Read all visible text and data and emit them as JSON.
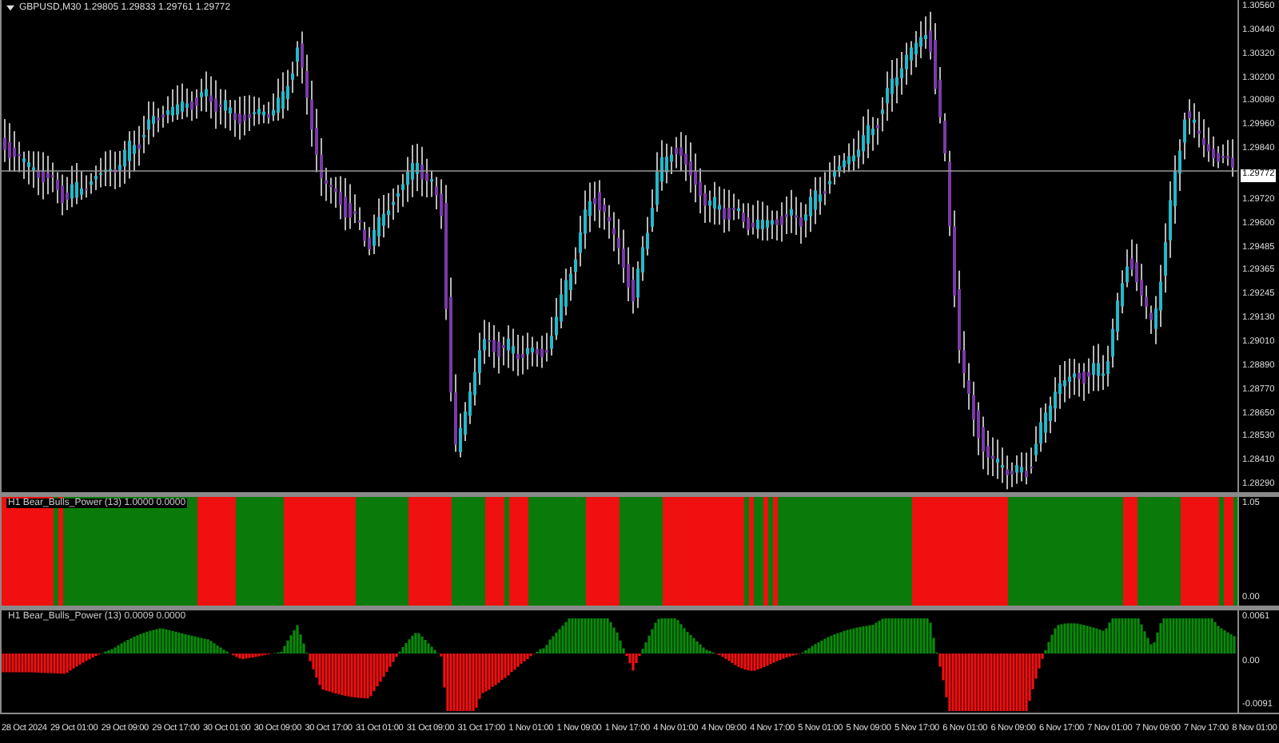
{
  "main_chart": {
    "title": "GBPUSD,M30  1.29805 1.29833 1.29761 1.29772",
    "current_price": "1.29772",
    "price_axis": [
      "1.30560",
      "1.30440",
      "1.30320",
      "1.30200",
      "1.30080",
      "1.29960",
      "1.29840",
      "1.29720",
      "1.29600",
      "1.29485",
      "1.29365",
      "1.29245",
      "1.29130",
      "1.29010",
      "1.28890",
      "1.28770",
      "1.28650",
      "1.28530",
      "1.28410",
      "1.28290"
    ]
  },
  "indicators": [
    {
      "kind": "color_bars",
      "label": "H1 Bear_Bulls_Power (13)  1.0000 0.0000",
      "axis": [
        "1.05",
        "0.00"
      ]
    },
    {
      "kind": "histogram",
      "label": "H1 Bear_Bulls_Power (13)  0.0009 0.0000",
      "axis": [
        "0.0061",
        "0.00",
        "-0.0091"
      ]
    }
  ],
  "time_axis": [
    "28 Oct 2024",
    "29 Oct 01:00",
    "29 Oct 09:00",
    "29 Oct 17:00",
    "30 Oct 01:00",
    "30 Oct 09:00",
    "30 Oct 17:00",
    "31 Oct 01:00",
    "31 Oct 09:00",
    "31 Oct 17:00",
    "1 Nov 01:00",
    "1 Nov 09:00",
    "1 Nov 17:00",
    "4 Nov 01:00",
    "4 Nov 09:00",
    "4 Nov 17:00",
    "5 Nov 01:00",
    "5 Nov 09:00",
    "5 Nov 17:00",
    "6 Nov 01:00",
    "6 Nov 09:00",
    "6 Nov 17:00",
    "7 Nov 01:00",
    "7 Nov 09:00",
    "7 Nov 17:00",
    "8 Nov 01:00"
  ]
}
